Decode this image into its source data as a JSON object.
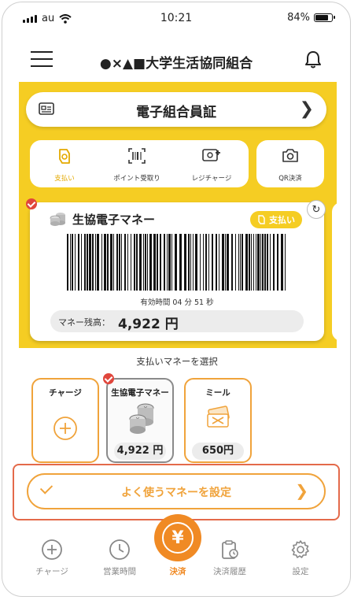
{
  "status_bar": {
    "carrier": "au",
    "time": "10:21",
    "battery": "84%",
    "battery_level": 0.84
  },
  "header": {
    "title": "●×▲■大学生活協同組合"
  },
  "id_card": {
    "label": "電子組合員証"
  },
  "tabs": [
    {
      "label": "支払い",
      "icon": "wallet-icon",
      "active": true
    },
    {
      "label": "ポイント受取り",
      "icon": "barcode-scan-icon",
      "active": false
    },
    {
      "label": "レジチャージ",
      "icon": "register-charge-icon",
      "active": false
    }
  ],
  "qr_tab": {
    "label": "QR決済",
    "icon": "camera-icon"
  },
  "money_card": {
    "title": "生協電子マネー",
    "pay_badge": "支払い",
    "validity": "有効時間 04 分 51 秒",
    "balance_label": "マネー残高：",
    "balance_value": "4,922 円"
  },
  "select_money": {
    "label": "支払いマネーを選択",
    "cards": [
      {
        "title": "チャージ",
        "icon": "plus-circle-icon"
      },
      {
        "title": "生協電子マネー",
        "value": "4,922 円",
        "icon": "coins-icon",
        "selected": true
      },
      {
        "title": "ミール",
        "value": "650円",
        "icon": "meal-ticket-icon"
      }
    ]
  },
  "favorite_button": {
    "label": "よく使うマネーを設定"
  },
  "bottom_nav": [
    {
      "label": "チャージ",
      "icon": "plus-circle-icon"
    },
    {
      "label": "営業時間",
      "icon": "clock-icon"
    },
    {
      "label": "決済",
      "icon": "yen-icon",
      "active": true
    },
    {
      "label": "決済履歴",
      "icon": "history-clipboard-icon"
    },
    {
      "label": "設定",
      "icon": "gear-icon"
    }
  ],
  "colors": {
    "accent_yellow": "#f5cd23",
    "accent_orange": "#f08a24",
    "highlight_outline": "#e46a4a",
    "check_red": "#e0463c"
  }
}
